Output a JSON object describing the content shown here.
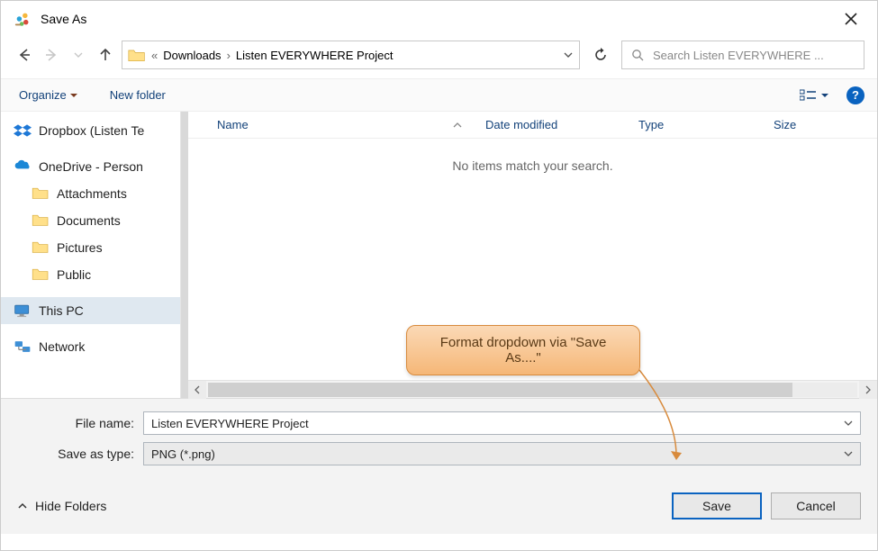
{
  "window": {
    "title": "Save As"
  },
  "nav": {
    "crumb_prefix": "«",
    "crumb1": "Downloads",
    "crumb2": "Listen EVERYWHERE Project",
    "search_placeholder": "Search Listen EVERYWHERE ..."
  },
  "toolbar": {
    "organize": "Organize",
    "new_folder": "New folder"
  },
  "tree": {
    "dropbox": "Dropbox (Listen Te",
    "onedrive": "OneDrive - Person",
    "attachments": "Attachments",
    "documents": "Documents",
    "pictures": "Pictures",
    "public": "Public",
    "this_pc": "This PC",
    "network": "Network"
  },
  "columns": {
    "name": "Name",
    "date": "Date modified",
    "type": "Type",
    "size": "Size"
  },
  "list": {
    "empty": "No items match your search."
  },
  "fields": {
    "filename_label": "File name:",
    "filename_value": "Listen EVERYWHERE Project",
    "type_label": "Save as type:",
    "type_value": "PNG (*.png)"
  },
  "bottom": {
    "hide_folders": "Hide Folders",
    "save": "Save",
    "cancel": "Cancel"
  },
  "annotation": {
    "text": "Format dropdown via \"Save As....\""
  }
}
